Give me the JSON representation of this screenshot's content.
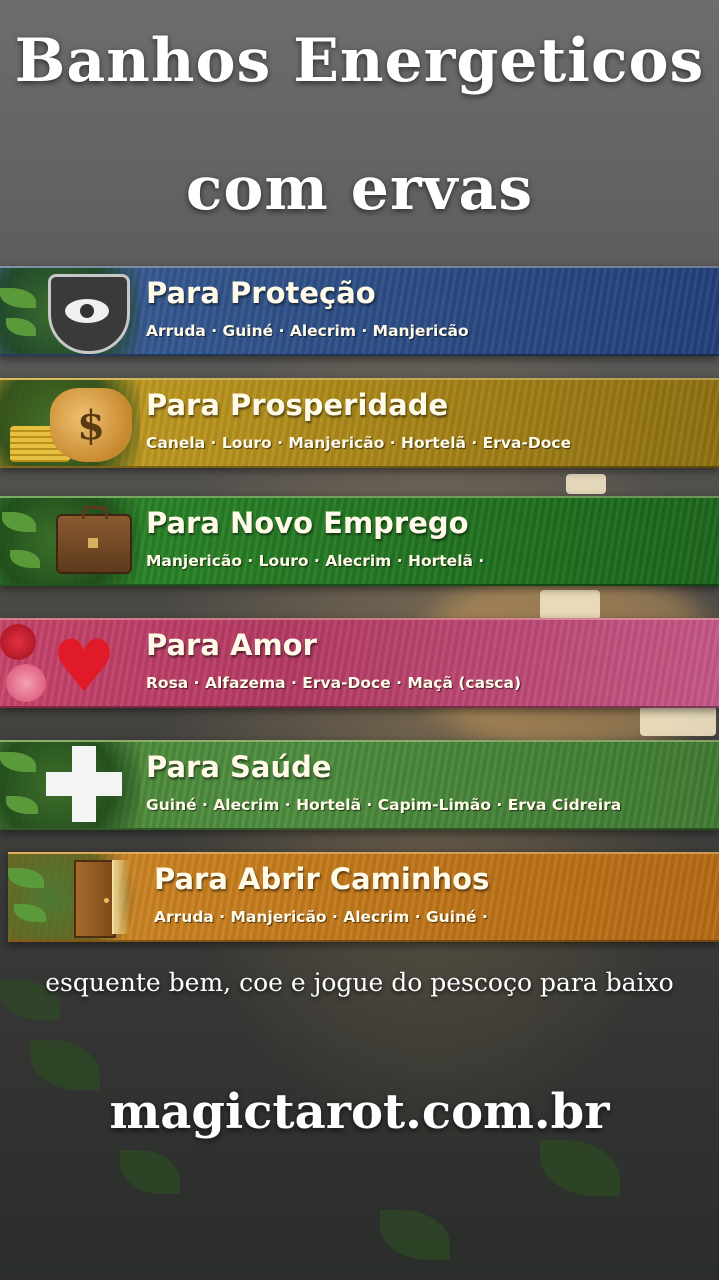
{
  "title": {
    "line1": "Banhos Energeticos",
    "line2": "com ervas"
  },
  "banners": [
    {
      "heading": "Para Proteção",
      "herbs": "Arruda · Guiné · Alecrim · Manjericão",
      "icon": "shield-eye-icon",
      "color": "#2f5189"
    },
    {
      "heading": "Para Prosperidade",
      "herbs": "Canela · Louro · Manjericão · Hortelã · Erva-Doce",
      "icon": "money-bag-icon",
      "color": "#b08c1a"
    },
    {
      "heading": "Para Novo Emprego",
      "herbs": "Manjericão · Louro · Alecrim · Hortelã ·",
      "icon": "briefcase-icon",
      "color": "#257a24"
    },
    {
      "heading": "Para Amor",
      "herbs": "Rosa · Alfazema · Erva-Doce · Maçã (casca)",
      "icon": "heart-icon",
      "color": "#b43a63"
    },
    {
      "heading": "Para Saúde",
      "herbs": "Guiné · Alecrim · Hortelã · Capim-Limão · Erva Cidreira",
      "icon": "cross-icon",
      "color": "#4d8c3e"
    },
    {
      "heading": "Para Abrir Caminhos",
      "herbs": "Arruda · Manjericão · Alecrim · Guiné ·",
      "icon": "door-icon",
      "color": "#c47a1c"
    }
  ],
  "tagline": "esquente bem, coe e jogue do pescoço para baixo",
  "site": "magictarot.com.br"
}
